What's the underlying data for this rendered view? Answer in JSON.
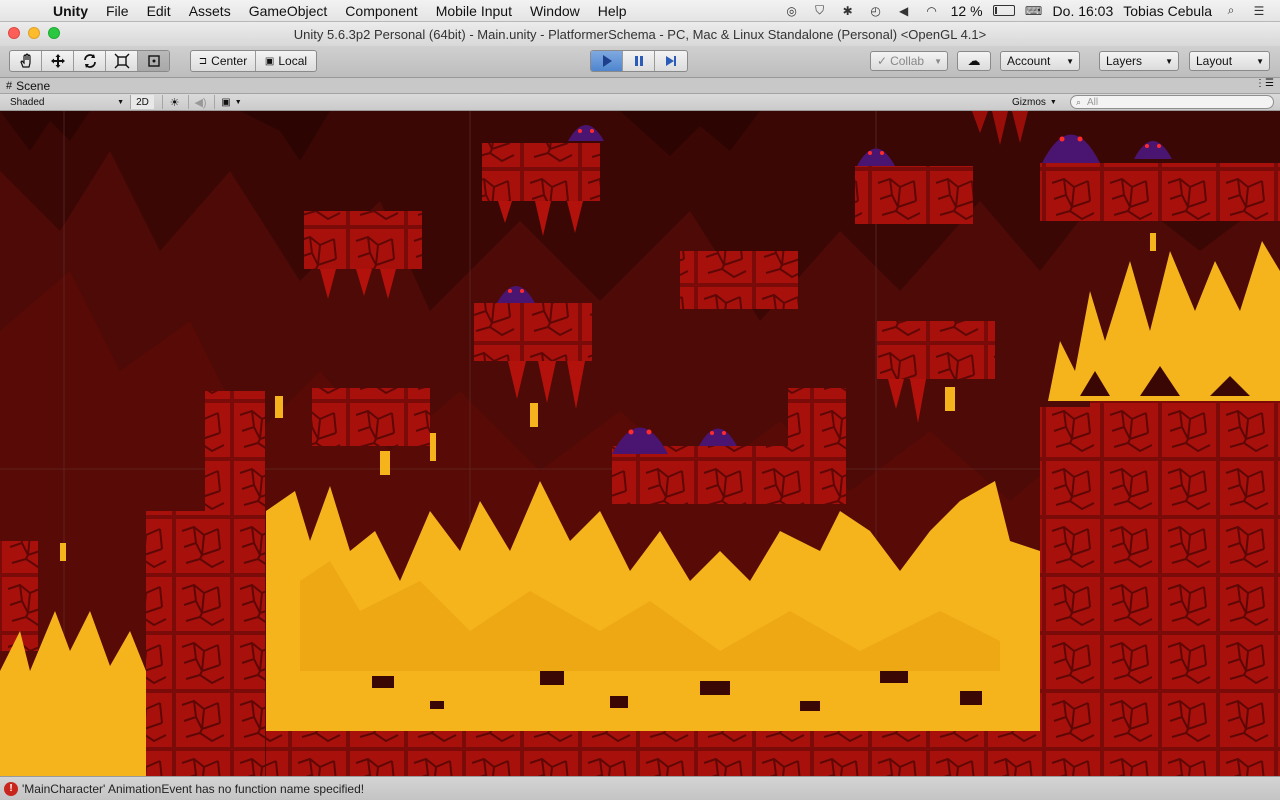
{
  "menubar": {
    "app": "Unity",
    "items": [
      "File",
      "Edit",
      "Assets",
      "GameObject",
      "Component",
      "Mobile Input",
      "Window",
      "Help"
    ],
    "battery": "12 %",
    "clock": "Do. 16:03",
    "user": "Tobias Cebula",
    "battery_level": 0.12
  },
  "window": {
    "title": "Unity 5.6.3p2 Personal (64bit) - Main.unity - PlatformerSchema - PC, Mac & Linux Standalone (Personal) <OpenGL 4.1>"
  },
  "toolbar": {
    "center_label": "Center",
    "local_label": "Local",
    "collab_label": "Collab",
    "account_label": "Account",
    "layers_label": "Layers",
    "layout_label": "Layout",
    "play_active": true
  },
  "scene_panel": {
    "tab_label": "Scene",
    "shading_mode": "Shaded",
    "mode_2d_label": "2D",
    "gizmos_label": "Gizmos",
    "search_placeholder": "All"
  },
  "console": {
    "message": "'MainCharacter' AnimationEvent has no function name specified!"
  },
  "colors": {
    "lava": "#f6b41c",
    "brick": "#a8100c",
    "enemy": "#4a1570",
    "background": "#3a0704",
    "play_blue": "#4f86cf"
  }
}
